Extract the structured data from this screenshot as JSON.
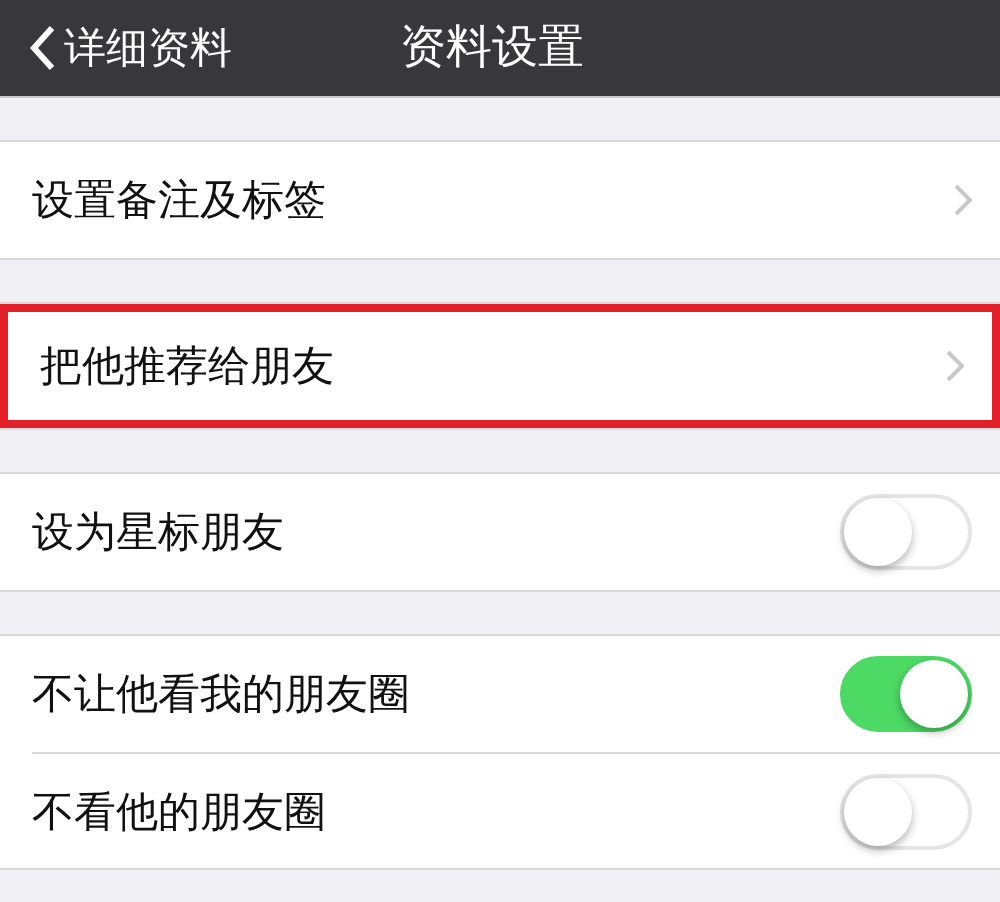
{
  "nav_bar": {
    "back_label": "详细资料",
    "title": "资料设置"
  },
  "groups": [
    {
      "rows": [
        {
          "kind": "link",
          "label": "设置备注及标签",
          "highlighted": false
        }
      ]
    },
    {
      "rows": [
        {
          "kind": "link",
          "label": "把他推荐给朋友",
          "highlighted": true
        }
      ]
    },
    {
      "rows": [
        {
          "kind": "switch",
          "label": "设为星标朋友",
          "on": false
        }
      ]
    },
    {
      "rows": [
        {
          "kind": "switch",
          "label": "不让他看我的朋友圈",
          "on": true
        },
        {
          "kind": "switch",
          "label": "不看他的朋友圈",
          "on": false
        }
      ]
    }
  ]
}
